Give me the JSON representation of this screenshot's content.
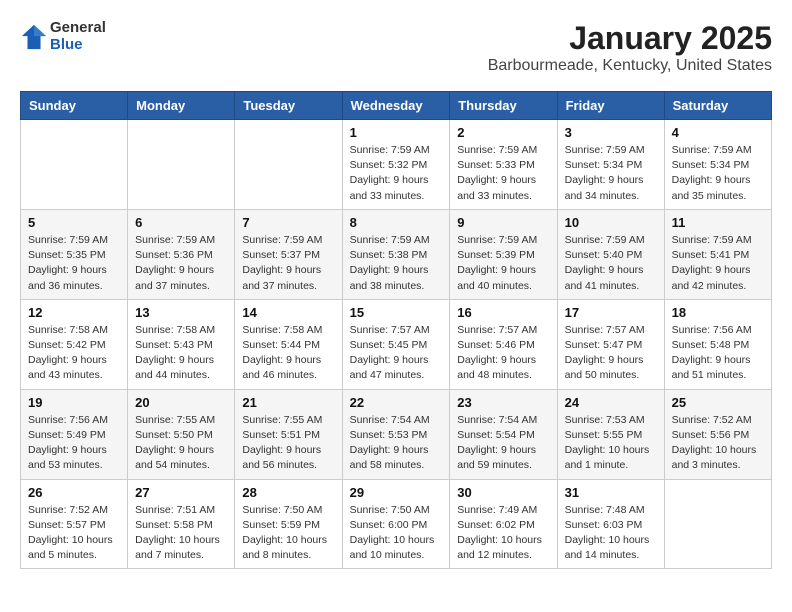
{
  "header": {
    "logo_general": "General",
    "logo_blue": "Blue",
    "month": "January 2025",
    "location": "Barbourmeade, Kentucky, United States"
  },
  "weekdays": [
    "Sunday",
    "Monday",
    "Tuesday",
    "Wednesday",
    "Thursday",
    "Friday",
    "Saturday"
  ],
  "weeks": [
    [
      {
        "day": "",
        "info": ""
      },
      {
        "day": "",
        "info": ""
      },
      {
        "day": "",
        "info": ""
      },
      {
        "day": "1",
        "info": "Sunrise: 7:59 AM\nSunset: 5:32 PM\nDaylight: 9 hours and 33 minutes."
      },
      {
        "day": "2",
        "info": "Sunrise: 7:59 AM\nSunset: 5:33 PM\nDaylight: 9 hours and 33 minutes."
      },
      {
        "day": "3",
        "info": "Sunrise: 7:59 AM\nSunset: 5:34 PM\nDaylight: 9 hours and 34 minutes."
      },
      {
        "day": "4",
        "info": "Sunrise: 7:59 AM\nSunset: 5:34 PM\nDaylight: 9 hours and 35 minutes."
      }
    ],
    [
      {
        "day": "5",
        "info": "Sunrise: 7:59 AM\nSunset: 5:35 PM\nDaylight: 9 hours and 36 minutes."
      },
      {
        "day": "6",
        "info": "Sunrise: 7:59 AM\nSunset: 5:36 PM\nDaylight: 9 hours and 37 minutes."
      },
      {
        "day": "7",
        "info": "Sunrise: 7:59 AM\nSunset: 5:37 PM\nDaylight: 9 hours and 37 minutes."
      },
      {
        "day": "8",
        "info": "Sunrise: 7:59 AM\nSunset: 5:38 PM\nDaylight: 9 hours and 38 minutes."
      },
      {
        "day": "9",
        "info": "Sunrise: 7:59 AM\nSunset: 5:39 PM\nDaylight: 9 hours and 40 minutes."
      },
      {
        "day": "10",
        "info": "Sunrise: 7:59 AM\nSunset: 5:40 PM\nDaylight: 9 hours and 41 minutes."
      },
      {
        "day": "11",
        "info": "Sunrise: 7:59 AM\nSunset: 5:41 PM\nDaylight: 9 hours and 42 minutes."
      }
    ],
    [
      {
        "day": "12",
        "info": "Sunrise: 7:58 AM\nSunset: 5:42 PM\nDaylight: 9 hours and 43 minutes."
      },
      {
        "day": "13",
        "info": "Sunrise: 7:58 AM\nSunset: 5:43 PM\nDaylight: 9 hours and 44 minutes."
      },
      {
        "day": "14",
        "info": "Sunrise: 7:58 AM\nSunset: 5:44 PM\nDaylight: 9 hours and 46 minutes."
      },
      {
        "day": "15",
        "info": "Sunrise: 7:57 AM\nSunset: 5:45 PM\nDaylight: 9 hours and 47 minutes."
      },
      {
        "day": "16",
        "info": "Sunrise: 7:57 AM\nSunset: 5:46 PM\nDaylight: 9 hours and 48 minutes."
      },
      {
        "day": "17",
        "info": "Sunrise: 7:57 AM\nSunset: 5:47 PM\nDaylight: 9 hours and 50 minutes."
      },
      {
        "day": "18",
        "info": "Sunrise: 7:56 AM\nSunset: 5:48 PM\nDaylight: 9 hours and 51 minutes."
      }
    ],
    [
      {
        "day": "19",
        "info": "Sunrise: 7:56 AM\nSunset: 5:49 PM\nDaylight: 9 hours and 53 minutes."
      },
      {
        "day": "20",
        "info": "Sunrise: 7:55 AM\nSunset: 5:50 PM\nDaylight: 9 hours and 54 minutes."
      },
      {
        "day": "21",
        "info": "Sunrise: 7:55 AM\nSunset: 5:51 PM\nDaylight: 9 hours and 56 minutes."
      },
      {
        "day": "22",
        "info": "Sunrise: 7:54 AM\nSunset: 5:53 PM\nDaylight: 9 hours and 58 minutes."
      },
      {
        "day": "23",
        "info": "Sunrise: 7:54 AM\nSunset: 5:54 PM\nDaylight: 9 hours and 59 minutes."
      },
      {
        "day": "24",
        "info": "Sunrise: 7:53 AM\nSunset: 5:55 PM\nDaylight: 10 hours and 1 minute."
      },
      {
        "day": "25",
        "info": "Sunrise: 7:52 AM\nSunset: 5:56 PM\nDaylight: 10 hours and 3 minutes."
      }
    ],
    [
      {
        "day": "26",
        "info": "Sunrise: 7:52 AM\nSunset: 5:57 PM\nDaylight: 10 hours and 5 minutes."
      },
      {
        "day": "27",
        "info": "Sunrise: 7:51 AM\nSunset: 5:58 PM\nDaylight: 10 hours and 7 minutes."
      },
      {
        "day": "28",
        "info": "Sunrise: 7:50 AM\nSunset: 5:59 PM\nDaylight: 10 hours and 8 minutes."
      },
      {
        "day": "29",
        "info": "Sunrise: 7:50 AM\nSunset: 6:00 PM\nDaylight: 10 hours and 10 minutes."
      },
      {
        "day": "30",
        "info": "Sunrise: 7:49 AM\nSunset: 6:02 PM\nDaylight: 10 hours and 12 minutes."
      },
      {
        "day": "31",
        "info": "Sunrise: 7:48 AM\nSunset: 6:03 PM\nDaylight: 10 hours and 14 minutes."
      },
      {
        "day": "",
        "info": ""
      }
    ]
  ]
}
